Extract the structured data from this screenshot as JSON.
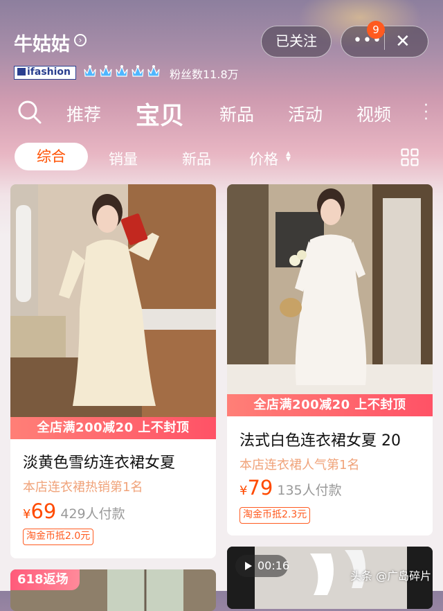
{
  "shop": {
    "name": "牛姑姑",
    "badge_text": "ifashion",
    "fans_label": "粉丝数11.8万",
    "follow_label": "已关注",
    "notification_count": "9",
    "more_label": "•••",
    "close_label": "✕"
  },
  "tabs": [
    "推荐",
    "宝贝",
    "新品",
    "活动",
    "视频"
  ],
  "active_tab": "宝贝",
  "sort": {
    "active": "综合",
    "items": [
      "销量",
      "新品",
      "价格"
    ]
  },
  "products": [
    {
      "promo": "全店满200减20 上不封顶",
      "title": "淡黄色雪纺连衣裙女夏",
      "rank": "本店连衣裙热销第1名",
      "currency": "¥",
      "price": "69",
      "sold": "429人付款",
      "coin": "淘金币抵2.0元"
    },
    {
      "promo": "全店满200减20 上不封顶",
      "title": "法式白色连衣裙女夏 20",
      "rank": "本店连衣裙人气第1名",
      "currency": "¥",
      "price": "79",
      "sold": "135人付款",
      "coin": "淘金币抵2.3元"
    }
  ],
  "next_row": {
    "left_tag": "618返场",
    "right_video_duration": "00:16"
  },
  "watermark": "头条 @广岛碎片",
  "colors": {
    "accent": "#ff5000",
    "promo": "#ff5a70",
    "rank_text": "#f0a37a",
    "badge": "#ff5a1f"
  }
}
